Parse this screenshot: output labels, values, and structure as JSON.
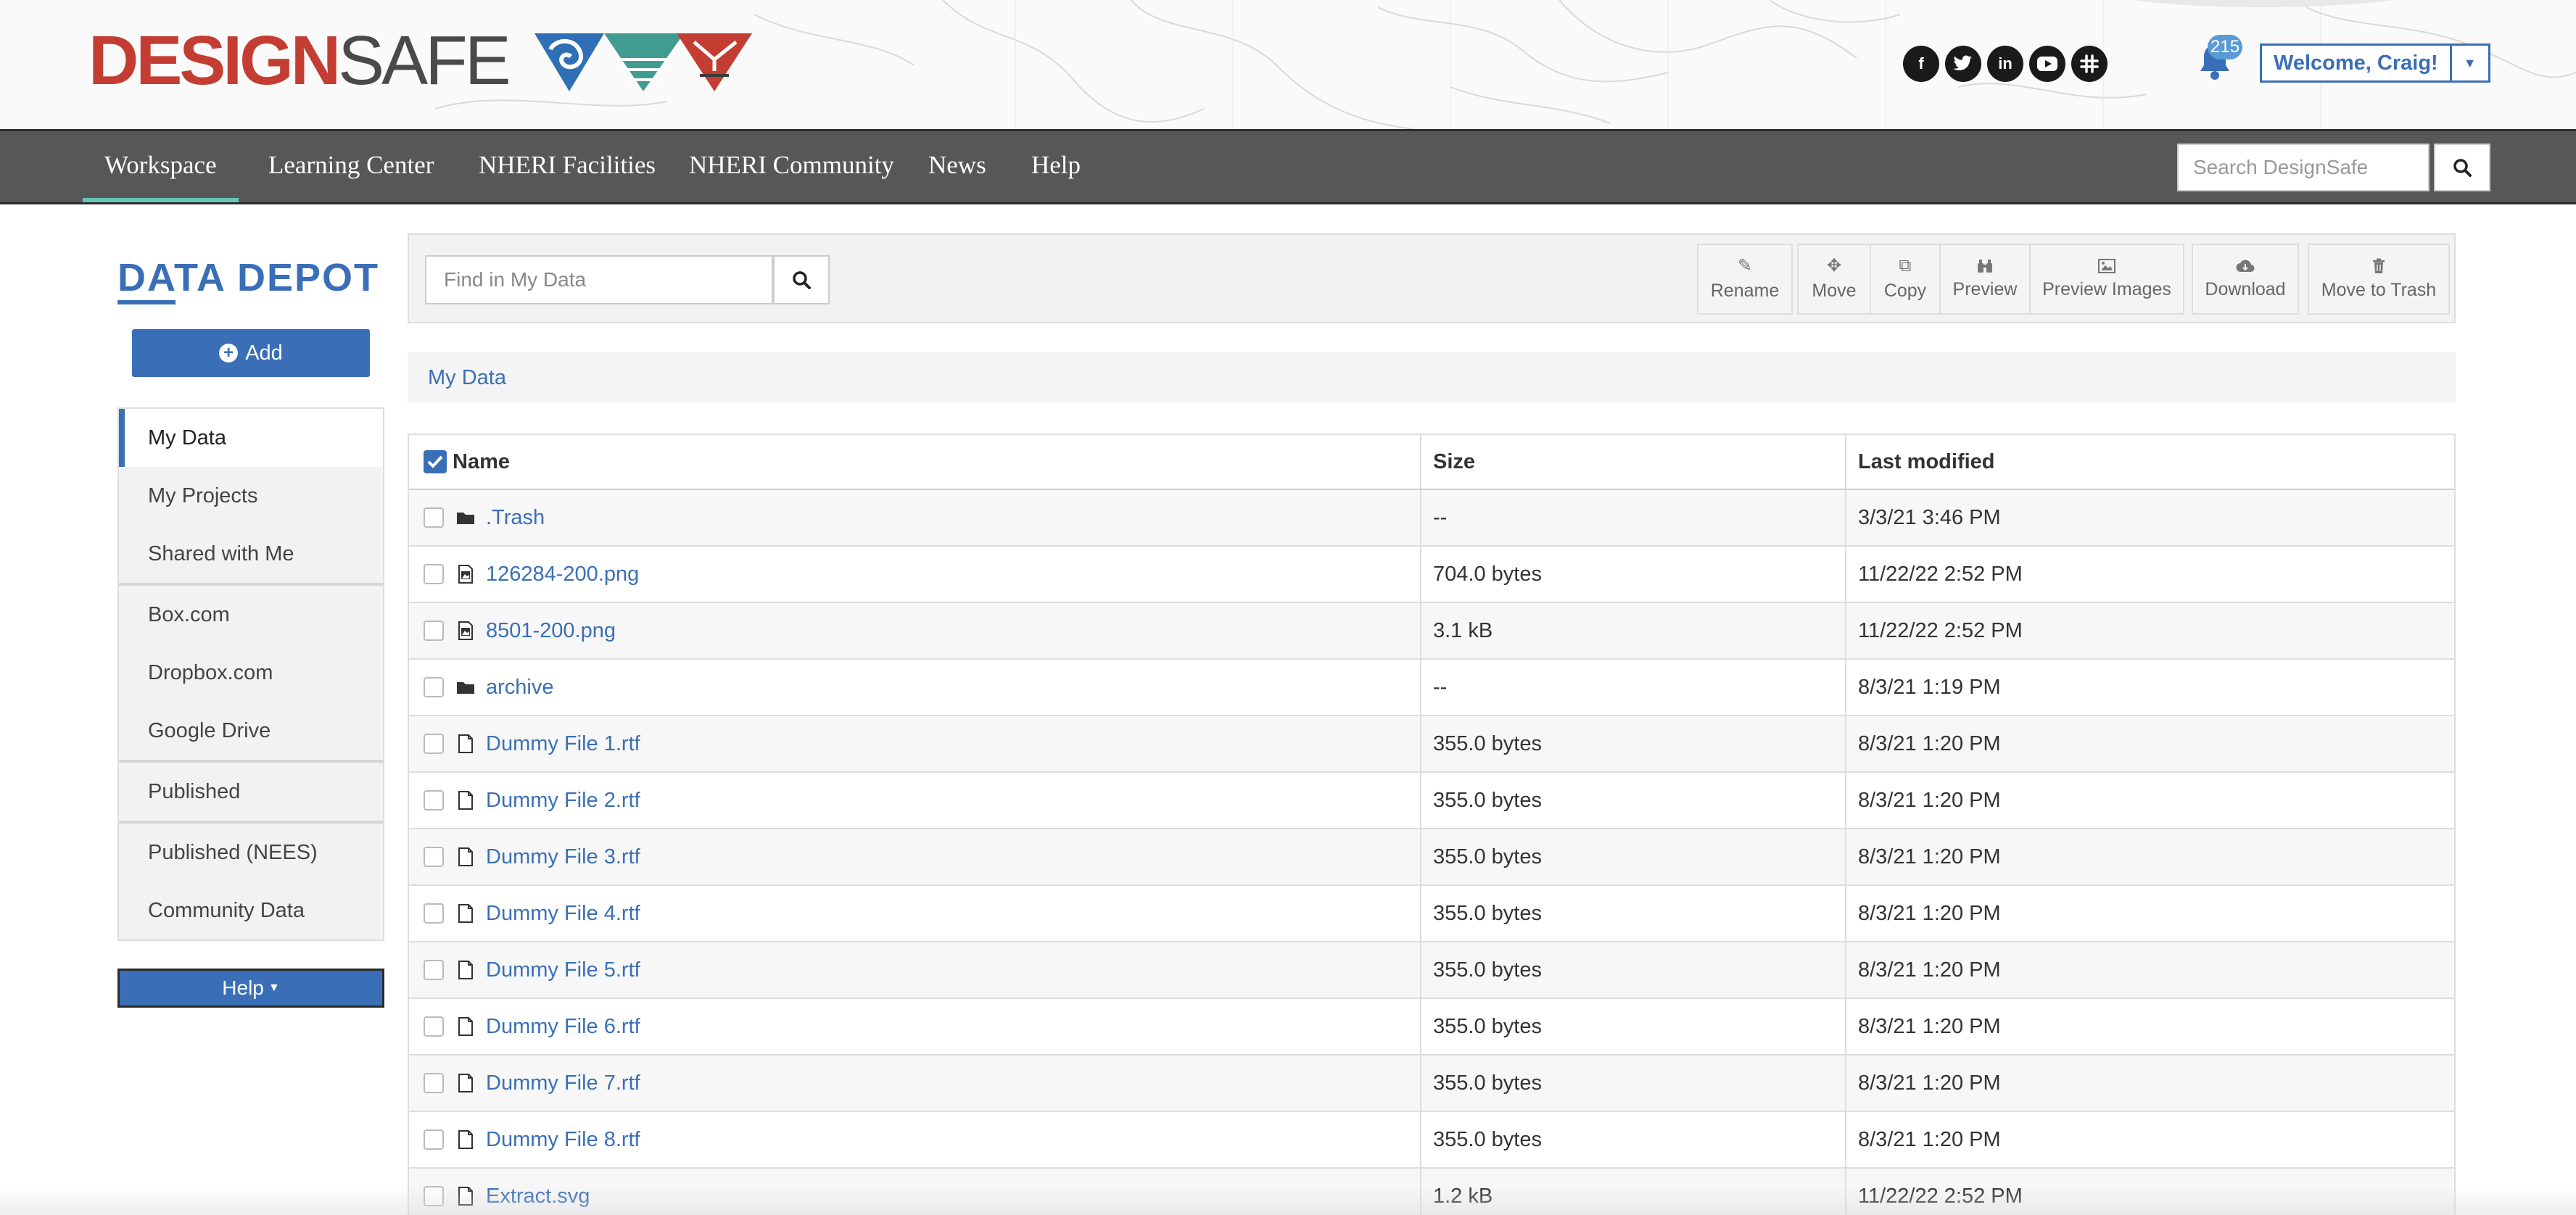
{
  "header": {
    "logo_design": "DESIGN",
    "logo_safe": "SAFE",
    "social_icons": [
      "facebook-icon",
      "twitter-icon",
      "linkedin-icon",
      "youtube-icon",
      "slack-icon"
    ],
    "notification_count": "215",
    "welcome_label": "Welcome, Craig!"
  },
  "nav": {
    "items": [
      "Workspace",
      "Learning Center",
      "NHERI Facilities",
      "NHERI Community",
      "News",
      "Help"
    ],
    "active": "Workspace",
    "search_placeholder": "Search DesignSafe"
  },
  "sidebar": {
    "title": "DATA DEPOT",
    "add_label": "Add",
    "groups": [
      [
        "My Data",
        "My Projects",
        "Shared with Me"
      ],
      [
        "Box.com",
        "Dropbox.com",
        "Google Drive"
      ],
      [
        "Published"
      ],
      [
        "Published (NEES)",
        "Community Data"
      ]
    ],
    "active": "My Data",
    "help_label": "Help"
  },
  "toolbar": {
    "find_placeholder": "Find in My Data",
    "buttons": [
      "Rename",
      "Move",
      "Copy",
      "Preview",
      "Preview Images",
      "Download",
      "Move to Trash"
    ]
  },
  "breadcrumb": "My Data",
  "table": {
    "columns": [
      "Name",
      "Size",
      "Last modified"
    ],
    "rows": [
      {
        "name": ".Trash",
        "type": "folder",
        "size": "--",
        "modified": "3/3/21 3:46 PM"
      },
      {
        "name": "126284-200.png",
        "type": "image",
        "size": "704.0 bytes",
        "modified": "11/22/22 2:52 PM"
      },
      {
        "name": "8501-200.png",
        "type": "image",
        "size": "3.1 kB",
        "modified": "11/22/22 2:52 PM"
      },
      {
        "name": "archive",
        "type": "folder",
        "size": "--",
        "modified": "8/3/21 1:19 PM"
      },
      {
        "name": "Dummy File 1.rtf",
        "type": "file",
        "size": "355.0 bytes",
        "modified": "8/3/21 1:20 PM"
      },
      {
        "name": "Dummy File 2.rtf",
        "type": "file",
        "size": "355.0 bytes",
        "modified": "8/3/21 1:20 PM"
      },
      {
        "name": "Dummy File 3.rtf",
        "type": "file",
        "size": "355.0 bytes",
        "modified": "8/3/21 1:20 PM"
      },
      {
        "name": "Dummy File 4.rtf",
        "type": "file",
        "size": "355.0 bytes",
        "modified": "8/3/21 1:20 PM"
      },
      {
        "name": "Dummy File 5.rtf",
        "type": "file",
        "size": "355.0 bytes",
        "modified": "8/3/21 1:20 PM"
      },
      {
        "name": "Dummy File 6.rtf",
        "type": "file",
        "size": "355.0 bytes",
        "modified": "8/3/21 1:20 PM"
      },
      {
        "name": "Dummy File 7.rtf",
        "type": "file",
        "size": "355.0 bytes",
        "modified": "8/3/21 1:20 PM"
      },
      {
        "name": "Dummy File 8.rtf",
        "type": "file",
        "size": "355.0 bytes",
        "modified": "8/3/21 1:20 PM"
      },
      {
        "name": "Extract.svg",
        "type": "file",
        "size": "1.2 kB",
        "modified": "11/22/22 2:52 PM"
      }
    ]
  },
  "colors": {
    "brand_red": "#c43d33",
    "brand_blue": "#3a6fb7",
    "nav_bg": "#575757",
    "nav_active_underline": "#67c6b3"
  }
}
